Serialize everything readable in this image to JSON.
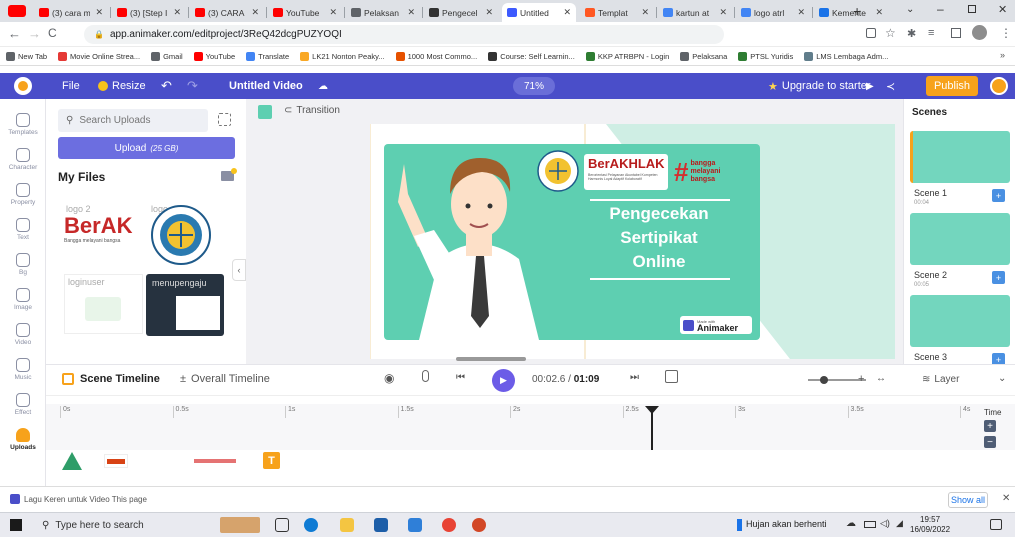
{
  "browser": {
    "tabs": [
      {
        "label": "(3) cara m",
        "favicon": "#ff0000"
      },
      {
        "label": "(3) [Step I",
        "favicon": "#ff0000"
      },
      {
        "label": "(3) CARA",
        "favicon": "#ff0000"
      },
      {
        "label": "YouTube",
        "favicon": "#ff0000"
      },
      {
        "label": "Pelaksan",
        "favicon": "#5f6368"
      },
      {
        "label": "Pengecel",
        "favicon": "#333333"
      },
      {
        "label": "Untitled",
        "favicon": "#3d5afe"
      },
      {
        "label": "Templat",
        "favicon": "#ff5722"
      },
      {
        "label": "kartun at",
        "favicon": "#4285f4"
      },
      {
        "label": "logo atrl",
        "favicon": "#4285f4"
      },
      {
        "label": "Kemente",
        "favicon": "#1a73e8"
      }
    ],
    "new_tab_label": "+",
    "url": "app.animaker.com/editproject/3ReQ42dcgPUZYOQI",
    "bookmarks": [
      {
        "label": "New Tab",
        "color": "#5f6368"
      },
      {
        "label": "Movie Online Strea...",
        "color": "#e53935"
      },
      {
        "label": "Gmail",
        "color": "#5f6368"
      },
      {
        "label": "YouTube",
        "color": "#ff0000"
      },
      {
        "label": "Translate",
        "color": "#4285f4"
      },
      {
        "label": "LK21 Nonton Peaky...",
        "color": "#f9a825"
      },
      {
        "label": "1000 Most Commo...",
        "color": "#e65100"
      },
      {
        "label": "Course: Self Learnin...",
        "color": "#333333"
      },
      {
        "label": "KKP ATRBPN - Login",
        "color": "#2e7d32"
      },
      {
        "label": "Pelaksana",
        "color": "#5f6368"
      },
      {
        "label": "PTSL Yuridis",
        "color": "#2e7d32"
      },
      {
        "label": "LMS Lembaga Adm...",
        "color": "#607d8b"
      }
    ]
  },
  "app": {
    "file_label": "File",
    "resize_label": "Resize",
    "project_title": "Untitled Video",
    "zoom": "71%",
    "upgrade_label": "Upgrade to starter",
    "publish_label": "Publish",
    "accent": "#4a4ec9",
    "publish_color": "#f7a21b"
  },
  "rail": [
    {
      "label": "Templates",
      "icon": "templates-icon"
    },
    {
      "label": "Character",
      "icon": "character-icon"
    },
    {
      "label": "Property",
      "icon": "property-icon"
    },
    {
      "label": "Text",
      "icon": "text-icon"
    },
    {
      "label": "Bg",
      "icon": "background-icon"
    },
    {
      "label": "Image",
      "icon": "image-icon"
    },
    {
      "label": "Video",
      "icon": "video-icon"
    },
    {
      "label": "Music",
      "icon": "music-icon"
    },
    {
      "label": "Effect",
      "icon": "effect-icon"
    },
    {
      "label": "Uploads",
      "icon": "uploads-icon"
    }
  ],
  "uploads": {
    "search_placeholder": "Search Uploads",
    "upload_label": "Upload",
    "upload_quota": "(25 GB)",
    "section_title": "My Files",
    "files": [
      {
        "name": "logo 2",
        "thumb_text": "BerAK",
        "thumb_sub": "Bangga melayani bangsa"
      },
      {
        "name": "logo",
        "thumb_text": ""
      },
      {
        "name": "loginuser",
        "thumb_text": ""
      },
      {
        "name": "menupengaju",
        "thumb_text": ""
      }
    ]
  },
  "stage": {
    "transition_label": "Transition",
    "slide": {
      "brand": "BerAKHLAK",
      "brand_sub": "Berorientasi Pelayanan Akuntabel Kompeten Harmonis Loyal Adaptif Kolaboratif",
      "hashtag": "bangga melayani bangsa",
      "title_lines": [
        "Pengecekan",
        "Sertipikat",
        "Online"
      ],
      "watermark_small": "Made with",
      "watermark": "Animaker",
      "bg": "#5ecfb1"
    }
  },
  "scenes": {
    "header": "Scenes",
    "items": [
      {
        "name": "Scene 1",
        "duration": "00:04"
      },
      {
        "name": "Scene 2",
        "duration": "00:05"
      },
      {
        "name": "Scene 3",
        "duration": ""
      }
    ]
  },
  "timeline": {
    "scene_timeline_label": "Scene Timeline",
    "overall_timeline_label": "Overall Timeline",
    "current_time": "00:02.6",
    "total_time": "01:09",
    "layer_label": "Layer",
    "ruler_ticks": [
      "0s",
      "0.5s",
      "1s",
      "1.5s",
      "2s",
      "2.5s",
      "3s",
      "3.5s",
      "4s"
    ],
    "time_label": "Time",
    "playhead_progress": 0.65
  },
  "download_bar": {
    "file_label": "Lagu Keren untuk Video This page",
    "show_all_label": "Show all"
  },
  "taskbar": {
    "search_placeholder": "Type here to search",
    "weather": "Hujan akan berhenti",
    "time": "19:57",
    "date": "16/09/2022"
  }
}
